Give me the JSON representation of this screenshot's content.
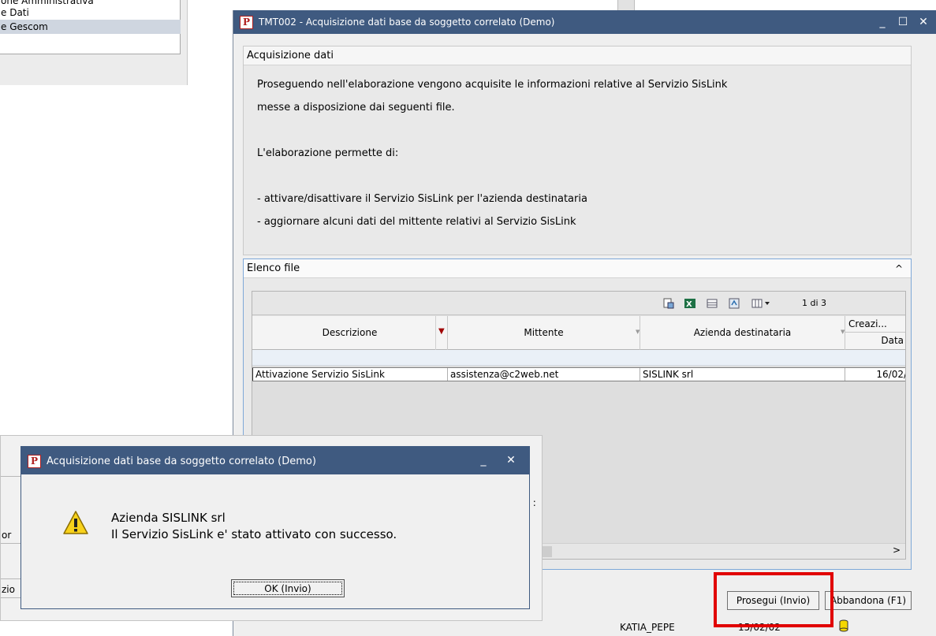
{
  "bg_list": {
    "items": [
      {
        "label": "one Amministrativa",
        "selected": false
      },
      {
        "label": "e Dati",
        "selected": false
      },
      {
        "label": "e Gescom",
        "selected": true
      }
    ]
  },
  "main_window": {
    "title": "TMT002 - Acquisizione dati base da soggetto correlato  (Demo)",
    "title_icon": "P",
    "controls": {
      "minimize": "_",
      "maximize": "☐",
      "close": "✕"
    },
    "info_section": {
      "header": "Acquisizione dati",
      "lines": [
        "Proseguendo nell'elaborazione vengono acquisite le informazioni relative al Servizio SisLink",
        "messe a disposizione dai seguenti file.",
        "",
        "L'elaborazione permette di:",
        "",
        "- attivare/disattivare il Servizio SisLink per l'azienda destinataria",
        "- aggiornare alcuni dati del mittente relativi al Servizio SisLink"
      ]
    },
    "files_section": {
      "header": "Elenco file",
      "collapse_glyph": "^",
      "pager": "1 di 3",
      "columns": [
        {
          "label": "Descrizione"
        },
        {
          "label": "Mittente"
        },
        {
          "label": "Azienda destinataria"
        },
        {
          "label": "Creazi...",
          "sub": "Data"
        }
      ],
      "rows": [
        {
          "descrizione": "Attivazione Servizio SisLink",
          "mittente": "assistenza@c2web.net",
          "azienda": "SISLINK srl",
          "data": "16/02/"
        }
      ],
      "scroll_right": ">"
    },
    "buttons": {
      "proceed": "Prosegui (Invio)",
      "abort": "Abbandona (F1)"
    },
    "status": {
      "user": "KATIA_PEPE",
      "date": "15/02/02"
    }
  },
  "dialog": {
    "title": "Acquisizione dati base da soggetto correlato  (Demo)",
    "title_icon": "P",
    "controls": {
      "minimize": "_",
      "close": "✕"
    },
    "line1": "Azienda SISLINK srl",
    "line2": "Il Servizio SisLink e' stato attivato con successo.",
    "ok_button": "OK (Invio)",
    "behind": {
      "left_labels": [
        "",
        "or",
        "",
        "zio"
      ],
      "right_text": "di :"
    }
  }
}
